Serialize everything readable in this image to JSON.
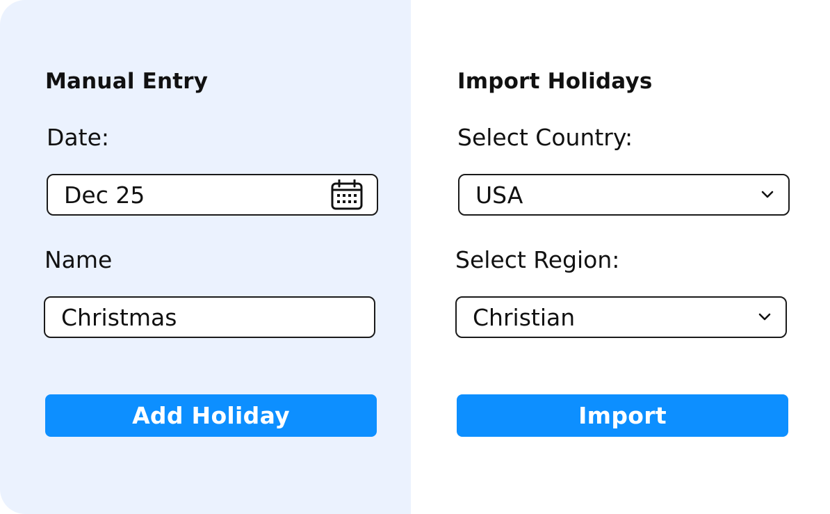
{
  "manual_entry": {
    "title": "Manual Entry",
    "date_label": "Date:",
    "date_value": "Dec 25",
    "name_label": "Name",
    "name_value": "Christmas",
    "add_button_label": "Add Holiday"
  },
  "import_holidays": {
    "title": "Import Holidays",
    "country_label": "Select Country:",
    "country_value": "USA",
    "region_label": "Select Region:",
    "region_value": "Christian",
    "import_button_label": "Import"
  },
  "icons": {
    "date_field": "calendar-icon",
    "country_dropdown": "chevron-down-icon",
    "region_dropdown": "chevron-down-icon"
  },
  "colors": {
    "left_panel_background": "#ebf2fe",
    "right_panel_background": "#ffffff",
    "button_background": "#0d8fff",
    "button_text": "#ffffff",
    "field_border": "#1a1a1a"
  }
}
